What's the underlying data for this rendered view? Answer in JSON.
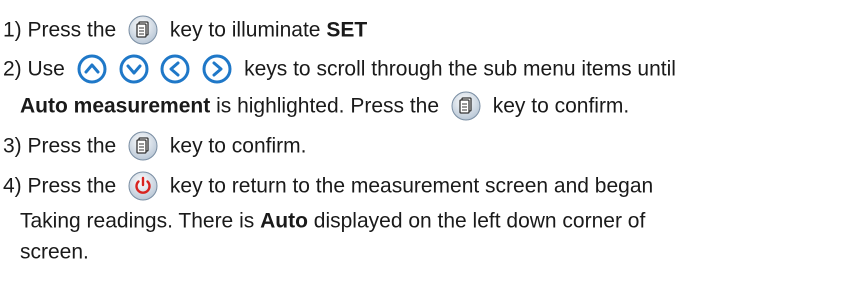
{
  "steps": [
    {
      "prefix": "1) Press the",
      "after_icon": "key to illuminate",
      "bold": "SET",
      "icon": "menu-set-key-icon"
    },
    {
      "prefix": "2) Use",
      "after_icons": "keys to scroll through the sub menu items until",
      "icons": [
        "up-arrow-key-icon",
        "down-arrow-key-icon",
        "left-arrow-key-icon",
        "right-arrow-key-icon"
      ],
      "line2_bold": "Auto measurement",
      "line2_text": "is highlighted. Press the",
      "line2_after_icon": "key to confirm.",
      "line2_icon": "menu-set-key-icon"
    },
    {
      "prefix": "3) Press the",
      "after_icon": "key to confirm.",
      "icon": "menu-set-key-icon"
    },
    {
      "prefix": "4) Press the",
      "after_icon": "key to return to the measurement screen and began",
      "icon": "power-key-icon",
      "line2_text": "Taking readings. There is",
      "line2_bold": "Auto",
      "line2_after": "displayed on the left down corner of",
      "line3_text": "screen."
    }
  ],
  "colors": {
    "key_blue": "#1f78c8",
    "power_red": "#d8231f"
  }
}
